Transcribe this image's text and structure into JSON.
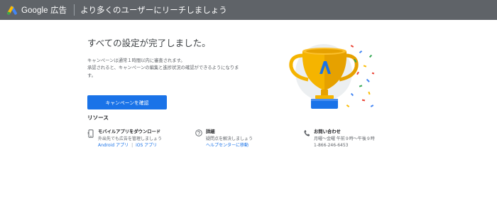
{
  "header": {
    "brand": "Google 広告",
    "page_title": "より多くのユーザーにリーチしましょう"
  },
  "main": {
    "headline": "すべての設定が完了しました。",
    "description_line1": "キャンペーンは通常１時間以内に審査されます。",
    "description_line2": "承認されると、キャンペーンの編集と進捗状況の確認ができるようになります。",
    "confirm_button": "キャンペーンを確認"
  },
  "resources": {
    "heading": "リソース",
    "items": [
      {
        "icon": "mobile-phone-icon",
        "title": "モバイルアプリをダウンロード",
        "line1": "外出先でも広告を管理しましょう",
        "link_android": "Android アプリ",
        "link_separator": "|",
        "link_ios": "iOS アプリ"
      },
      {
        "icon": "help-circle-icon",
        "title": "詳細",
        "line1": "疑問点を解決しましょう",
        "link": "ヘルプセンターに移動"
      },
      {
        "icon": "phone-icon",
        "title": "お問い合わせ",
        "line1": "月曜～金曜 午前９時～午後９時",
        "line2": "1-866-246-6453"
      }
    ]
  },
  "illustration": {
    "icon": "trophy-confetti-icon"
  },
  "colors": {
    "topbar": "#5f6368",
    "primary": "#1a73e8",
    "trophy_gold": "#f5b400",
    "trophy_dark": "#e6a100",
    "trophy_base": "#1a73e8"
  }
}
